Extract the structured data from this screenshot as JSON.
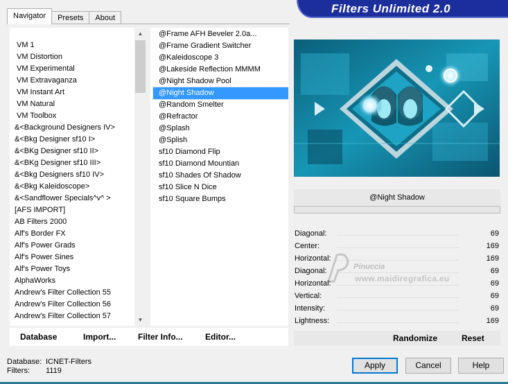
{
  "banner": {
    "title": "Filters Unlimited 2.0"
  },
  "tabs": [
    {
      "label": "Navigator",
      "active": true
    },
    {
      "label": "Presets",
      "active": false
    },
    {
      "label": "About",
      "active": false
    }
  ],
  "categories": [
    "VM 1",
    "VM Distortion",
    "VM Experimental",
    "VM Extravaganza",
    "VM Instant Art",
    "VM Natural",
    "VM Toolbox",
    "&<Background Designers IV>",
    "&<Bkg Designer sf10 I>",
    "&<BKg Designer sf10 II>",
    "&<BKg Designer sf10 III>",
    "&<Bkg Designers sf10 IV>",
    "&<Bkg Kaleidoscope>",
    "&<Sandflower Specials^v^ >",
    "[AFS IMPORT]",
    "AB Filters 2000",
    "Alf's Border FX",
    "Alf's Power Grads",
    "Alf's Power Sines",
    "Alf's Power Toys",
    "AlphaWorks",
    "Andrew's Filter Collection 55",
    "Andrew's Filter Collection 56",
    "Andrew's Filter Collection 57"
  ],
  "filters": [
    "@Frame AFH Beveler 2.0a...",
    "@Frame Gradient Switcher",
    "@Kaleidoscope 3",
    "@Lakeside Reflection MMMM",
    "@Night Shadow Pool",
    "@Night Shadow",
    "@Random Smelter",
    "@Refractor",
    "@Splash",
    "@Splish",
    "sf10 Diamond Flip",
    "sf10 Diamond Mountian",
    "sf10 Shades Of Shadow",
    "sf10 Slice N Dice",
    "sf10 Square Bumps"
  ],
  "selected_filter_index": 5,
  "bottom_buttons": {
    "database": "Database",
    "import": "Import...",
    "filter_info": "Filter Info...",
    "editor": "Editor..."
  },
  "current_filter": "@Night Shadow",
  "params": [
    {
      "name": "Diagonal:",
      "value": "69"
    },
    {
      "name": "Center:",
      "value": "169"
    },
    {
      "name": "Horizontal:",
      "value": "169"
    },
    {
      "name": "Diagonal:",
      "value": "69"
    },
    {
      "name": "Horizontal:",
      "value": "69"
    },
    {
      "name": "Vertical:",
      "value": "69"
    },
    {
      "name": "Intensity:",
      "value": "69"
    },
    {
      "name": "Lightness:",
      "value": "169"
    }
  ],
  "actions": {
    "randomize": "Randomize",
    "reset": "Reset"
  },
  "watermark": {
    "line1": "Pinuccia",
    "line2": "www.maidiregrafica.eu"
  },
  "footer": {
    "database_label": "Database:",
    "database_value": "ICNET-Filters",
    "filters_label": "Filters:",
    "filters_value": "1119"
  },
  "dialog_buttons": {
    "apply": "Apply",
    "cancel": "Cancel",
    "help": "Help"
  },
  "colors": {
    "banner": "#1c2e9c",
    "selection": "#3399ff",
    "preview": "#0e6f8b"
  }
}
